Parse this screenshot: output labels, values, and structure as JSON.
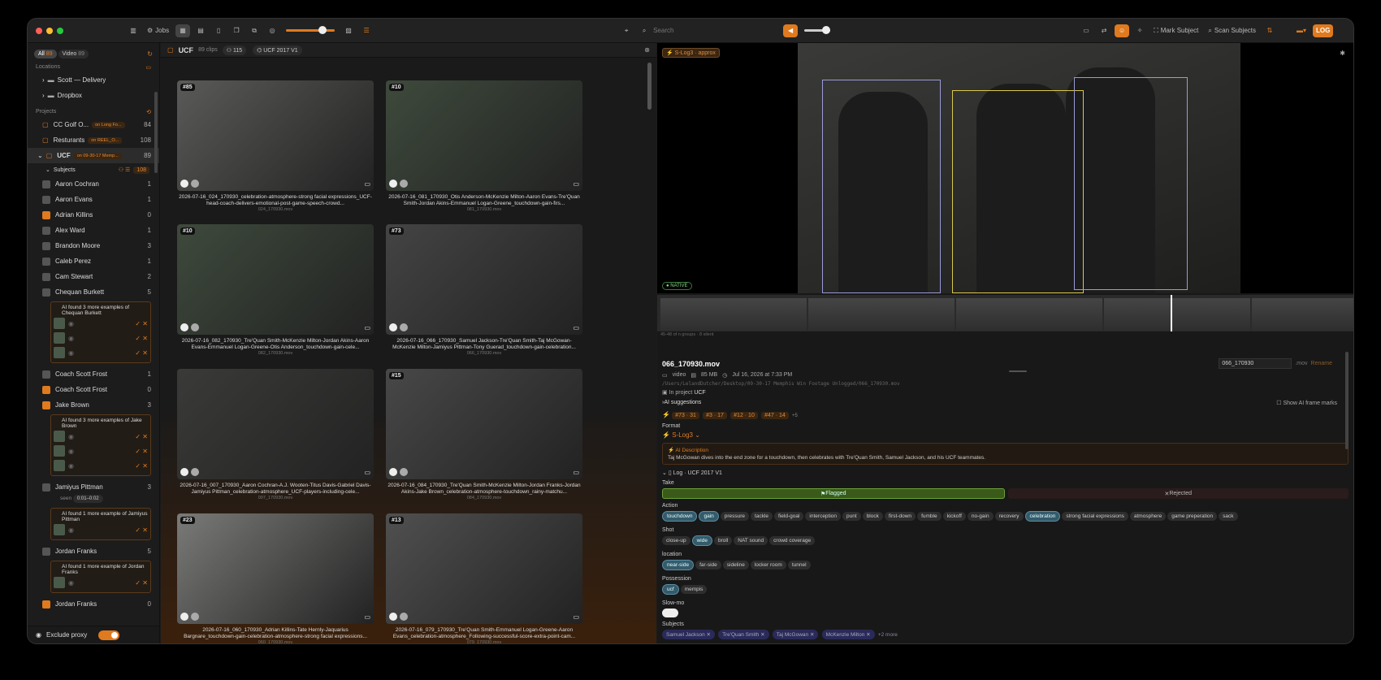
{
  "toolbar": {
    "jobs": "Jobs",
    "search_placeholder": "Search",
    "mark_subject": "Mark Subject",
    "scan_subjects": "Scan Subjects",
    "log": "LOG"
  },
  "sidebar": {
    "filters": [
      {
        "label": "All",
        "count": "89"
      },
      {
        "label": "Video",
        "count": "89"
      }
    ],
    "locations_title": "Locations",
    "locations": [
      "Scott — Delivery",
      "Dropbox"
    ],
    "projects_title": "Projects",
    "projects": [
      {
        "name": "CC Golf O...",
        "badge": "on Long Fo...",
        "count": "84"
      },
      {
        "name": "Resturants",
        "badge": "on REEL_O...",
        "count": "108"
      },
      {
        "name": "UCF",
        "badge": "on 09-30-17 Memp...",
        "count": "89"
      }
    ],
    "subjects_title": "Subjects",
    "subjects_count": "108",
    "subjects": [
      {
        "name": "Aaron Cochran",
        "count": "1"
      },
      {
        "name": "Aaron Evans",
        "count": "1"
      },
      {
        "name": "Adrian Killins",
        "count": "0"
      },
      {
        "name": "Alex Ward",
        "count": "1"
      },
      {
        "name": "Brandon Moore",
        "count": "3"
      },
      {
        "name": "Caleb Perez",
        "count": "1"
      },
      {
        "name": "Cam Stewart",
        "count": "2"
      },
      {
        "name": "Chequan Burkett",
        "count": "5"
      }
    ],
    "ai1": "AI found 3 more examples of Chequan Burkett",
    "subjects2": [
      {
        "name": "Coach Scott Frost",
        "count": "1"
      },
      {
        "name": "Coach Scott Frost",
        "count": "0"
      },
      {
        "name": "Jake Brown",
        "count": "3"
      }
    ],
    "ai2": "AI found 3 more examples of Jake Brown",
    "jamiyus": {
      "name": "Jamiyus Pittman",
      "count": "3",
      "seen": "seen",
      "range": "0:01–0:02"
    },
    "ai3": "AI found 1 more example of Jamiyus Pittman",
    "jordan": {
      "name": "Jordan Franks",
      "count": "5"
    },
    "ai4": "AI found 1 more example of Jordan Franks",
    "jordan2": {
      "name": "Jordan Franks",
      "count": "0"
    },
    "exclude_proxy": "Exclude proxy"
  },
  "grid": {
    "title": "UCF",
    "clips": "89 clips",
    "count": "115",
    "log": "UCF 2017 V1",
    "cards": [
      {
        "num": "#85",
        "cap": "2026-07-16_024_170930_celebration-atmosphere-strong facial expressions_UCF-head-coach-delivers-emotional-post-game-speech-crowd...",
        "file": "024_170930.mov"
      },
      {
        "num": "#10",
        "cap": "2026-07-16_081_170930_Otis Anderson-McKenzie Milton-Aaron Evans-Tre'Quan Smith-Jordan Akins-Emmanuel Logan-Greene_touchdown-gain-firs...",
        "file": "081_170930.mov"
      },
      {
        "num": "#10",
        "cap": "2026-07-16_082_170930_Tre'Quan Smith-McKenzie Milton-Jordan Akins-Aaron Evans-Emmanuel Logan-Greene-Otis Anderson_touchdown-gain-cele...",
        "file": "082_170930.mov"
      },
      {
        "num": "#73",
        "cap": "2026-07-16_066_170930_Samuel Jackson-Tre'Quan Smith-Taj McGowan-McKenzie Milton-Jamiyus Pittman-Tony Guerad_touchdown-gain-celebration...",
        "file": "066_170930.mov"
      },
      {
        "num": "",
        "cap": "2026-07-16_007_170930_Aaron Cochran-A.J. Wooten-Titus Davis-Gabriel Davis-Jamiyus Pittman_celebration-atmosphere_UCF-players-including-cele...",
        "file": "007_170930.mov"
      },
      {
        "num": "#15",
        "cap": "2026-07-16_084_170930_Tre'Quan Smith-McKenzie Milton-Jordan Franks-Jordan Akins-Jake Brown_celebration-atmosphere-touchdown_rainy-matchu...",
        "file": "084_170930.mov"
      },
      {
        "num": "#23",
        "cap": "2026-07-16_060_170930_Adrian Killins-Tate Hernly-Jaquarius Bargnare_touchdown-gain-celebration-atmosphere-strong facial expressions...",
        "file": "060_170930.mov"
      },
      {
        "num": "#13",
        "cap": "2026-07-16_079_170930_Tre'Quan Smith-Emmanuel Logan-Greene-Aaron Evans_celebration-atmosphere_Following-successful-score-extra-point-cam...",
        "file": "079_170930.mov"
      }
    ]
  },
  "viewer": {
    "slog": "S-Log3 · approx",
    "native": "NATIVE",
    "timeline": "45-48 of n groups · 8 silent"
  },
  "detail": {
    "filename": "066_170930.mov",
    "type": "video",
    "size": "85 MB",
    "date": "Jul 16, 2026 at 7:33 PM",
    "path": "/Users/LelandDutcher/Desktop/09-30-17 Memphis Win Footage Unlogged/066_170930.mov",
    "project": "In project",
    "project_name": "UCF",
    "rename_value": "066_170930",
    "ext": ".mov",
    "rename": "Rename",
    "ai_suggestions": "AI suggestions",
    "show_ai": "Show AI frame marks",
    "badges": [
      "#73 · 31",
      "#3 · 17",
      "#12 · 10",
      "#47 · 14"
    ],
    "more": "+5",
    "format_label": "Format",
    "format": "S-Log3",
    "ai_desc_title": "AI Description",
    "ai_desc": "Taj McGowan dives into the end zone for a touchdown, then celebrates with Tre'Quan Smith, Samuel Jackson, and his UCF teammates.",
    "log_title": "Log · UCF 2017 V1",
    "take": "Take",
    "flagged": "Flagged",
    "rejected": "Rejected",
    "action_label": "Action",
    "actions": [
      "touchdown",
      "gain",
      "pressure",
      "tackle",
      "field-goal",
      "interception",
      "punt",
      "block",
      "first-down",
      "fumble",
      "kickoff",
      "no-gain",
      "recovery",
      "celebration",
      "strong facial expressions",
      "atmosphere",
      "game preperation",
      "sack"
    ],
    "shot_label": "Shot",
    "shots": [
      "close-up",
      "wide",
      "broll",
      "NAT sound",
      "crowd coverage"
    ],
    "location_label": "location",
    "locations": [
      "near-side",
      "far-side",
      "sideline",
      "locker room",
      "tunnel"
    ],
    "possession_label": "Possession",
    "possession": [
      "ucf",
      "mempis"
    ],
    "slowmo_label": "Slow-mo",
    "subjects_label": "Subjects",
    "subjects": [
      "Samuel Jackson",
      "Tre'Quan Smith",
      "Taj McGowan",
      "McKenzie Milton"
    ],
    "subjects_more": "+2 more"
  }
}
